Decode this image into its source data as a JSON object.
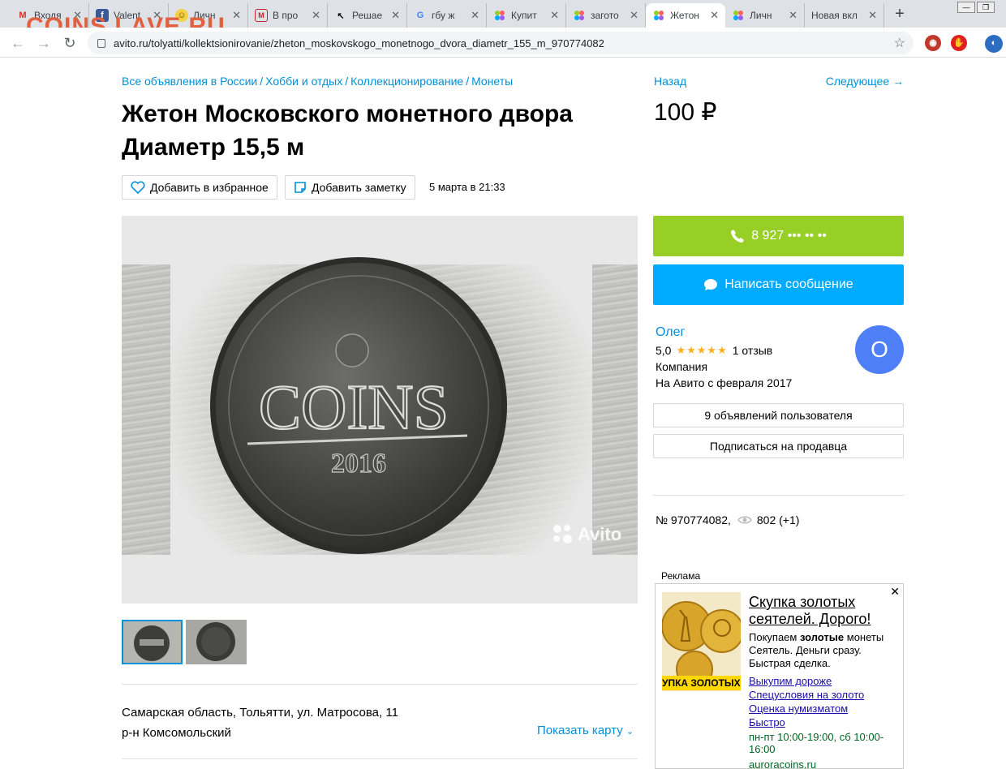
{
  "browser": {
    "watermark": "COINS.LAVE.RU",
    "tabs": [
      {
        "label": "Входя",
        "icon": "gmail-icon"
      },
      {
        "label": "Valent",
        "icon": "facebook-icon"
      },
      {
        "label": "Личн",
        "icon": "smiley-icon"
      },
      {
        "label": "В про",
        "icon": "mail-icon"
      },
      {
        "label": "Решае",
        "icon": "cursor-icon"
      },
      {
        "label": "гбу ж",
        "icon": "google-icon"
      },
      {
        "label": "Купит",
        "icon": "avito-icon"
      },
      {
        "label": "загото",
        "icon": "avito-icon"
      },
      {
        "label": "Жетон",
        "icon": "avito-icon"
      },
      {
        "label": "Личн",
        "icon": "avito-icon"
      },
      {
        "label": "Новая вкл",
        "icon": ""
      }
    ],
    "url": "avito.ru/tolyatti/kollektsionirovanie/zheton_moskovskogo_monetnogo_dvora_diametr_155_m_970774082"
  },
  "breadcrumbs": [
    "Все объявления в России",
    "Хобби и отдых",
    "Коллекционирование",
    "Монеты"
  ],
  "listing": {
    "title_line1": "Жетон Московского монетного двора",
    "title_line2": "Диаметр 15,5 м",
    "price": "100 ₽",
    "nav_prev": "Назад",
    "nav_next": "Следующее →",
    "favorite_label": "Добавить в избранное",
    "note_label": "Добавить заметку",
    "date": "5 марта в 21:33",
    "watermark": "Avito",
    "coin_text": "COINS",
    "coin_year": "2016",
    "address_line1": "Самарская область, Тольятти, ул. Матросова, 11",
    "address_line2": "р-н Комсомольский",
    "show_map": "Показать карту"
  },
  "contact": {
    "phone_label": "8 927 ••• •• ••",
    "message_label": "Написать сообщение",
    "seller_name": "Олег",
    "rating_value": "5,0",
    "stars": "★★★★★",
    "reviews": "1 отзыв",
    "seller_type": "Компания",
    "seller_since": "На Авито с февраля 2017",
    "avatar_letter": "О",
    "listings_button": "9 объявлений пользователя",
    "subscribe_button": "Подписаться на продавца",
    "item_number": "№ 970774082,",
    "views": "802 (+1)"
  },
  "ad": {
    "label": "Реклама",
    "close": "✕",
    "banner": "УПКА ЗОЛОТЫХ",
    "headline": "Скупка золотых сеятелей. Дорого!",
    "text_before": "Покупаем ",
    "text_bold": "золотые",
    "text_after": " монеты Сеятель. Деньги сразу. Быстрая сделка.",
    "links": [
      "Выкупим дороже",
      "Спецусловия на золото",
      "Оценка нумизматом",
      "Быстро"
    ],
    "hours": "пн-пт 10:00-19:00, сб 10:00-16:00",
    "domain": "auroracoins.ru"
  },
  "colors": {
    "link": "#0091d9",
    "phone_button": "#97cf26",
    "message_button": "#00aaff",
    "avatar": "#4f7ff6",
    "stars": "#ffb021"
  }
}
